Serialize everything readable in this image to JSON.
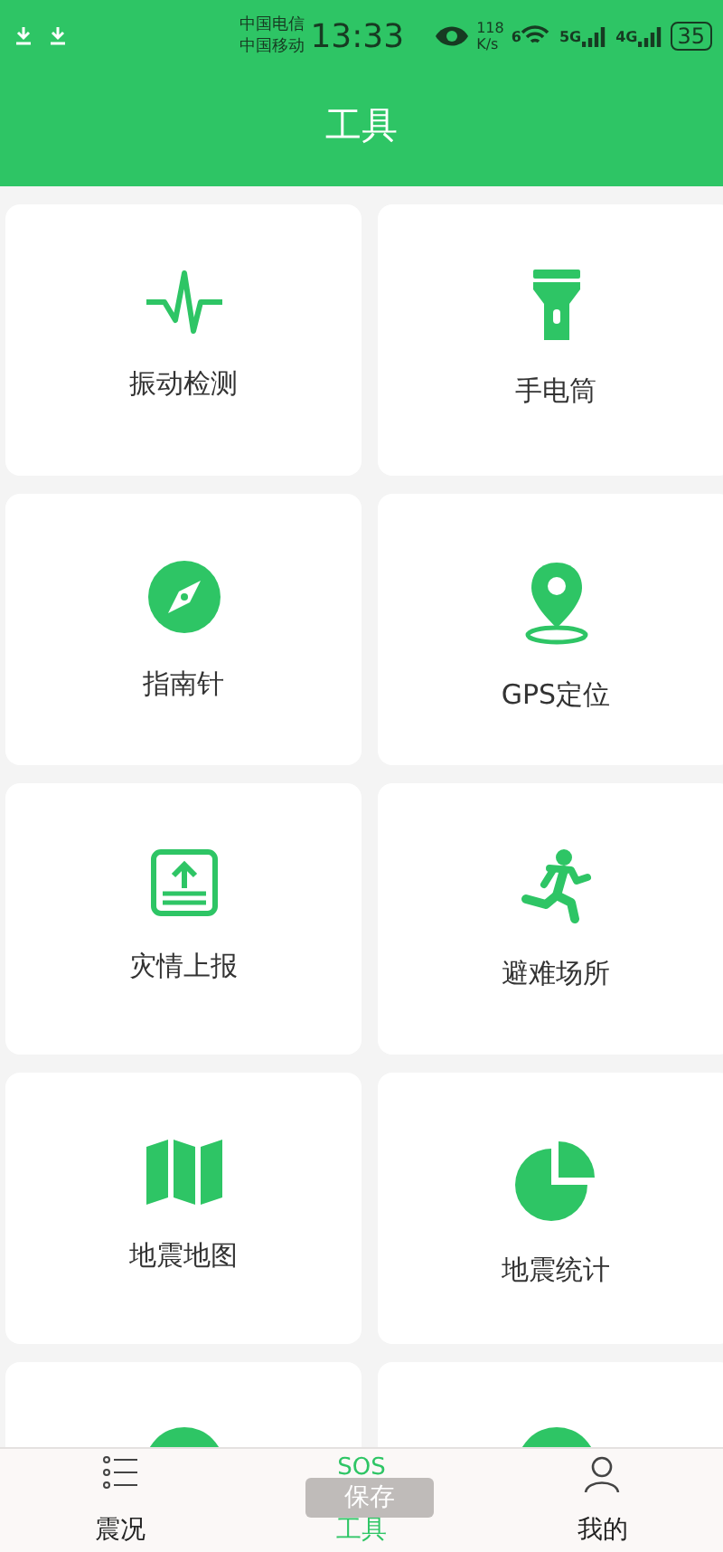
{
  "status_bar": {
    "carriers": [
      "中国电信",
      "中国移动"
    ],
    "time": "13:33",
    "speed": [
      "118",
      "K/s"
    ],
    "wifi_label": "6",
    "signals": [
      "5G",
      "4G"
    ],
    "battery": "35"
  },
  "header": {
    "title": "工具"
  },
  "tools": [
    {
      "label": "振动检测",
      "kind": "pulse"
    },
    {
      "label": "手电筒",
      "kind": "flashlight"
    },
    {
      "label": "指南针",
      "kind": "compass"
    },
    {
      "label": "GPS定位",
      "kind": "pin"
    },
    {
      "label": "灾情上报",
      "kind": "upload"
    },
    {
      "label": "避难场所",
      "kind": "runner"
    },
    {
      "label": "地震地图",
      "kind": "map"
    },
    {
      "label": "地震统计",
      "kind": "pie"
    },
    {
      "kind": "circle"
    },
    {
      "kind": "circle"
    }
  ],
  "nav": [
    {
      "label": "震况",
      "kind": "list",
      "selected": false
    },
    {
      "label": "工具",
      "kind": "sos",
      "icon_text": "SOS",
      "selected": true
    },
    {
      "label": "我的",
      "kind": "user",
      "selected": false
    }
  ],
  "toast": {
    "text": "保存"
  }
}
